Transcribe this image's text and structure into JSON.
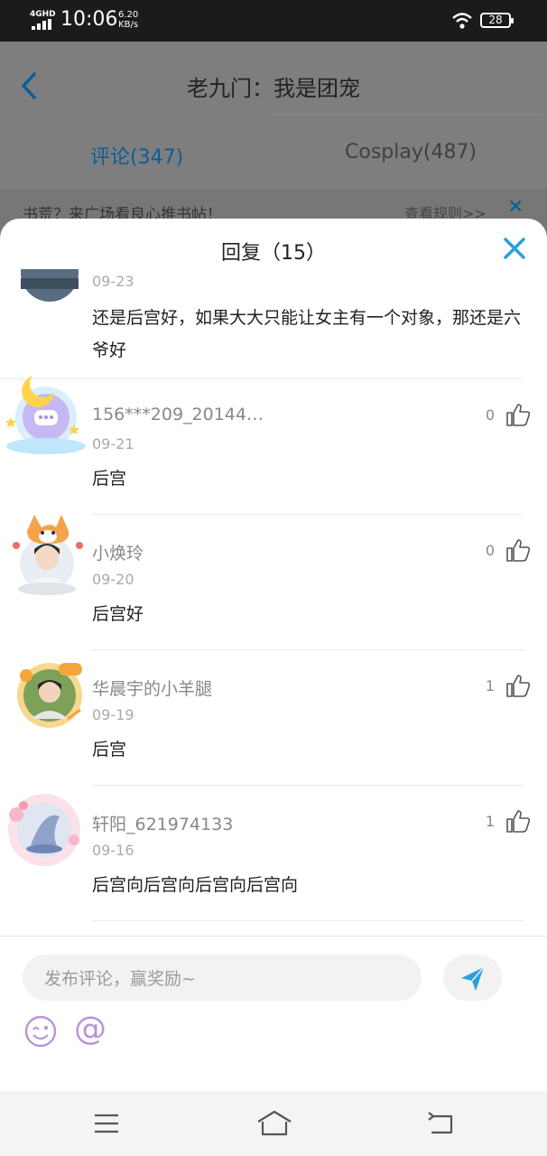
{
  "status_bar": {
    "network": "4GHD",
    "time": "10:06",
    "speed_value": "6.20",
    "speed_unit": "KB/s",
    "battery": "28"
  },
  "background_page": {
    "title": "老九门：我是团宠",
    "tabs": [
      {
        "label": "评论(347)",
        "active": true
      },
      {
        "label": "Cosplay(487)",
        "active": false
      }
    ],
    "banner_text": "书荒？来广场看良心推书帖！",
    "banner_link": "查看规则>>"
  },
  "sheet": {
    "title": "回复（15）",
    "comments": [
      {
        "username": "",
        "date": "09-23",
        "text": "还是后宫好，如果大大只能让女主有一个对象，那还是六爷好",
        "likes": ""
      },
      {
        "username": "156***209_20144…",
        "date": "09-21",
        "text": "后宫",
        "likes": "0"
      },
      {
        "username": "小焕玲",
        "date": "09-20",
        "text": "后宫好",
        "likes": "0"
      },
      {
        "username": "华晨宇的小羊腿",
        "date": "09-19",
        "text": "后宫",
        "likes": "1"
      },
      {
        "username": "轩阳_621974133",
        "date": "09-16",
        "text": "后宫向后宫向后宫向后宫向",
        "likes": "1"
      }
    ]
  },
  "composer": {
    "placeholder": "发布评论，赢奖励~",
    "at_symbol": "@"
  },
  "colors": {
    "accent_blue": "#2a9fe0",
    "background_accent": "#0b5e97",
    "text_dark": "#222222",
    "text_gray": "#888888"
  },
  "icons": [
    "back-arrow-icon",
    "close-icon",
    "thumb-up-icon",
    "send-icon",
    "emoji-icon",
    "at-icon",
    "menu-icon",
    "home-icon",
    "back-icon",
    "wifi-icon",
    "signal-icon"
  ]
}
